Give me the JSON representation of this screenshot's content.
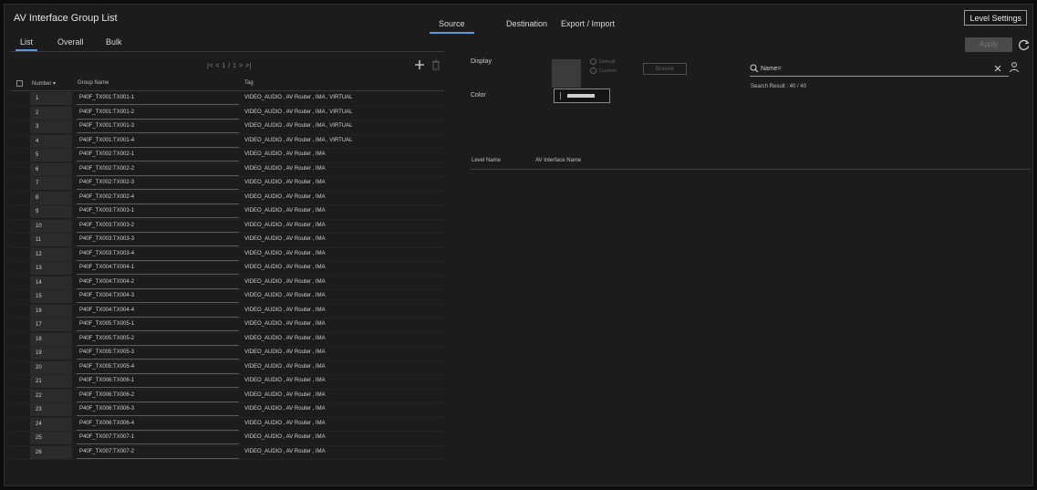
{
  "window": {
    "title": "AV Interface Group List"
  },
  "top_tabs": [
    {
      "label": "Source",
      "active": true
    },
    {
      "label": "Destination",
      "active": false
    },
    {
      "label": "Export / Import",
      "active": false
    }
  ],
  "level_settings_label": "Level Settings",
  "sub_tabs": [
    {
      "label": "List",
      "active": true
    },
    {
      "label": "Overall",
      "active": false
    },
    {
      "label": "Bulk",
      "active": false
    }
  ],
  "apply_label": "Apply",
  "pager_text": "|< < 1 / 1 > >|",
  "table": {
    "headers": {
      "number": "Number ▾",
      "group_name": "Group Name",
      "tag": "Tag"
    },
    "rows": [
      {
        "number": "1",
        "group_name": "P40F_TX001:TX001-1",
        "tag": "VIDEO_AUDIO , AV Router , IMA , VIRTUAL"
      },
      {
        "number": "2",
        "group_name": "P40F_TX001:TX001-2",
        "tag": "VIDEO_AUDIO , AV Router , IMA , VIRTUAL"
      },
      {
        "number": "3",
        "group_name": "P40F_TX001:TX001-3",
        "tag": "VIDEO_AUDIO , AV Router , IMA , VIRTUAL"
      },
      {
        "number": "4",
        "group_name": "P40F_TX001:TX001-4",
        "tag": "VIDEO_AUDIO , AV Router , IMA , VIRTUAL"
      },
      {
        "number": "5",
        "group_name": "P40F_TX002:TX002-1",
        "tag": "VIDEO_AUDIO , AV Router , IMA"
      },
      {
        "number": "6",
        "group_name": "P40F_TX002:TX002-2",
        "tag": "VIDEO_AUDIO , AV Router , IMA"
      },
      {
        "number": "7",
        "group_name": "P40F_TX002:TX002-3",
        "tag": "VIDEO_AUDIO , AV Router , IMA"
      },
      {
        "number": "8",
        "group_name": "P40F_TX002:TX002-4",
        "tag": "VIDEO_AUDIO , AV Router , IMA"
      },
      {
        "number": "9",
        "group_name": "P40F_TX003:TX003-1",
        "tag": "VIDEO_AUDIO , AV Router , IMA"
      },
      {
        "number": "10",
        "group_name": "P40F_TX003:TX003-2",
        "tag": "VIDEO_AUDIO , AV Router , IMA"
      },
      {
        "number": "11",
        "group_name": "P40F_TX003:TX003-3",
        "tag": "VIDEO_AUDIO , AV Router , IMA"
      },
      {
        "number": "12",
        "group_name": "P40F_TX003:TX003-4",
        "tag": "VIDEO_AUDIO , AV Router , IMA"
      },
      {
        "number": "13",
        "group_name": "P40F_TX004:TX004-1",
        "tag": "VIDEO_AUDIO , AV Router , IMA"
      },
      {
        "number": "14",
        "group_name": "P40F_TX004:TX004-2",
        "tag": "VIDEO_AUDIO , AV Router , IMA"
      },
      {
        "number": "15",
        "group_name": "P40F_TX004:TX004-3",
        "tag": "VIDEO_AUDIO , AV Router , IMA"
      },
      {
        "number": "16",
        "group_name": "P40F_TX004:TX004-4",
        "tag": "VIDEO_AUDIO , AV Router , IMA"
      },
      {
        "number": "17",
        "group_name": "P40F_TX005:TX005-1",
        "tag": "VIDEO_AUDIO , AV Router , IMA"
      },
      {
        "number": "18",
        "group_name": "P40F_TX005:TX005-2",
        "tag": "VIDEO_AUDIO , AV Router , IMA"
      },
      {
        "number": "19",
        "group_name": "P40F_TX005:TX005-3",
        "tag": "VIDEO_AUDIO , AV Router , IMA"
      },
      {
        "number": "20",
        "group_name": "P40F_TX005:TX005-4",
        "tag": "VIDEO_AUDIO , AV Router , IMA"
      },
      {
        "number": "21",
        "group_name": "P40F_TX006:TX006-1",
        "tag": "VIDEO_AUDIO , AV Router , IMA"
      },
      {
        "number": "22",
        "group_name": "P40F_TX006:TX006-2",
        "tag": "VIDEO_AUDIO , AV Router , IMA"
      },
      {
        "number": "23",
        "group_name": "P40F_TX006:TX006-3",
        "tag": "VIDEO_AUDIO , AV Router , IMA"
      },
      {
        "number": "24",
        "group_name": "P40F_TX006:TX006-4",
        "tag": "VIDEO_AUDIO , AV Router , IMA"
      },
      {
        "number": "25",
        "group_name": "P40F_TX007:TX007-1",
        "tag": "VIDEO_AUDIO , AV Router , IMA"
      },
      {
        "number": "26",
        "group_name": "P40F_TX007:TX007-2",
        "tag": "VIDEO_AUDIO , AV Router , IMA"
      }
    ]
  },
  "detail": {
    "display_label": "Display",
    "radio_options": [
      "Default",
      "Custom"
    ],
    "browse_label": "Browse",
    "color_label": "Color"
  },
  "search": {
    "placeholder": "Name=",
    "result_text": "Search Result : 40 / 40"
  },
  "level_table": {
    "headers": [
      "Level Name",
      "AV Interface Name"
    ]
  },
  "colors": {
    "accent": "#5a9bd6",
    "background": "#1c1c1c",
    "frame": "#0c0c0c"
  }
}
